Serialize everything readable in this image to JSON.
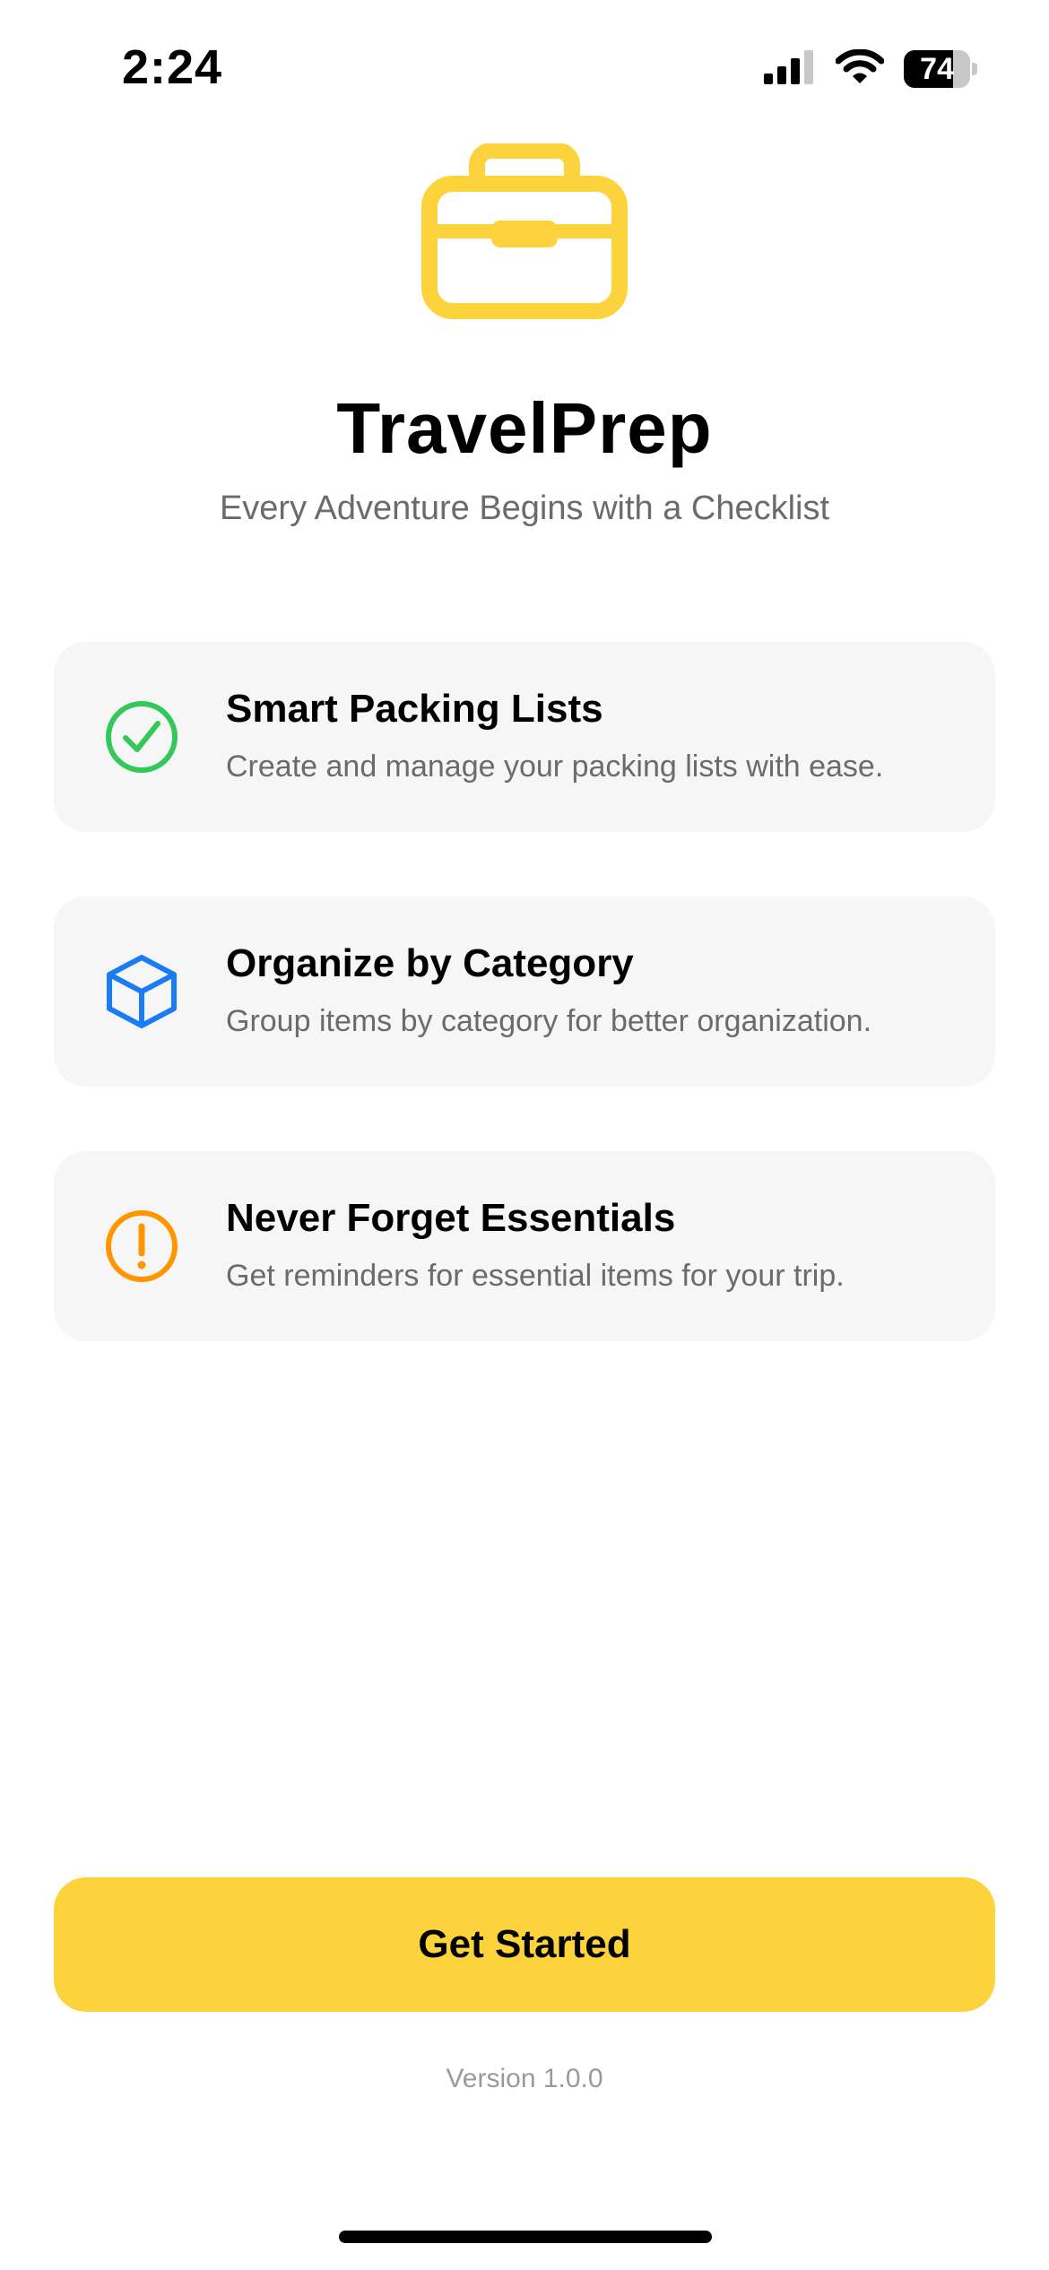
{
  "status_bar": {
    "time": "2:24",
    "battery_level": 74,
    "battery_text": "74",
    "icons": [
      "cellular-signal-icon",
      "wifi-icon",
      "battery-icon"
    ]
  },
  "header": {
    "logo_icon": "briefcase-icon",
    "title": "TravelPrep",
    "subtitle": "Every Adventure Begins with a Checklist"
  },
  "features": [
    {
      "icon": "checkmark-circle-icon",
      "icon_color": "#34c759",
      "title": "Smart Packing Lists",
      "description": "Create and manage your packing lists with ease."
    },
    {
      "icon": "cube-icon",
      "icon_color": "#1a7cf5",
      "title": "Organize by Category",
      "description": "Group items by category for better organization."
    },
    {
      "icon": "exclamation-circle-icon",
      "icon_color": "#ff9500",
      "title": "Never Forget Essentials",
      "description": "Get reminders for essential items for your trip."
    }
  ],
  "cta": {
    "label": "Get Started",
    "color": "#fcd33d"
  },
  "footer": {
    "version": "Version 1.0.0"
  },
  "colors": {
    "accent": "#fcd33d",
    "card_background": "#f6f6f6",
    "secondary_text": "#6b6b6b"
  }
}
